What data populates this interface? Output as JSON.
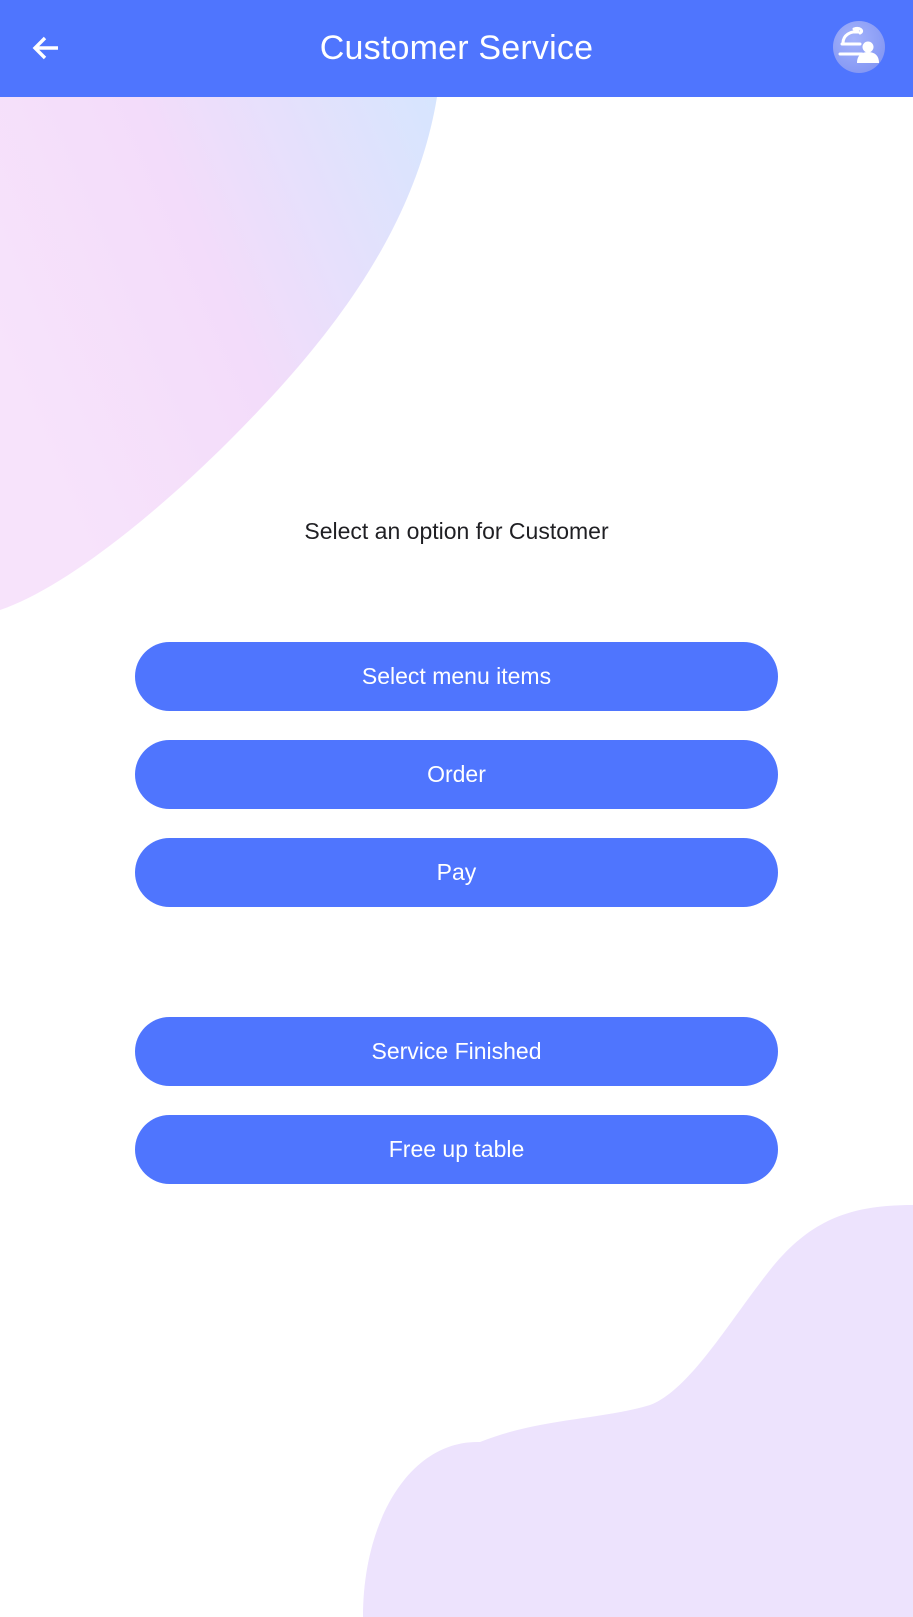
{
  "app_bar": {
    "title": "Customer Service",
    "back_icon": "arrow-left-icon",
    "avatar_icon": "waiter-serving-icon",
    "color": "#4f75fe"
  },
  "main": {
    "prompt": "Select an option for Customer",
    "actions": [
      {
        "label": "Select menu items"
      },
      {
        "label": "Order"
      },
      {
        "label": "Pay"
      },
      {
        "label": "Service Finished"
      },
      {
        "label": "Free up table"
      }
    ]
  },
  "colors": {
    "accent": "#4f75fe",
    "button_text": "#ffffff",
    "prompt_text": "#1f1f23",
    "blob_top_left_start": "#f5ddf9",
    "blob_top_left_end": "#d8e6fe",
    "blob_bottom_right": "#ede3fd"
  }
}
